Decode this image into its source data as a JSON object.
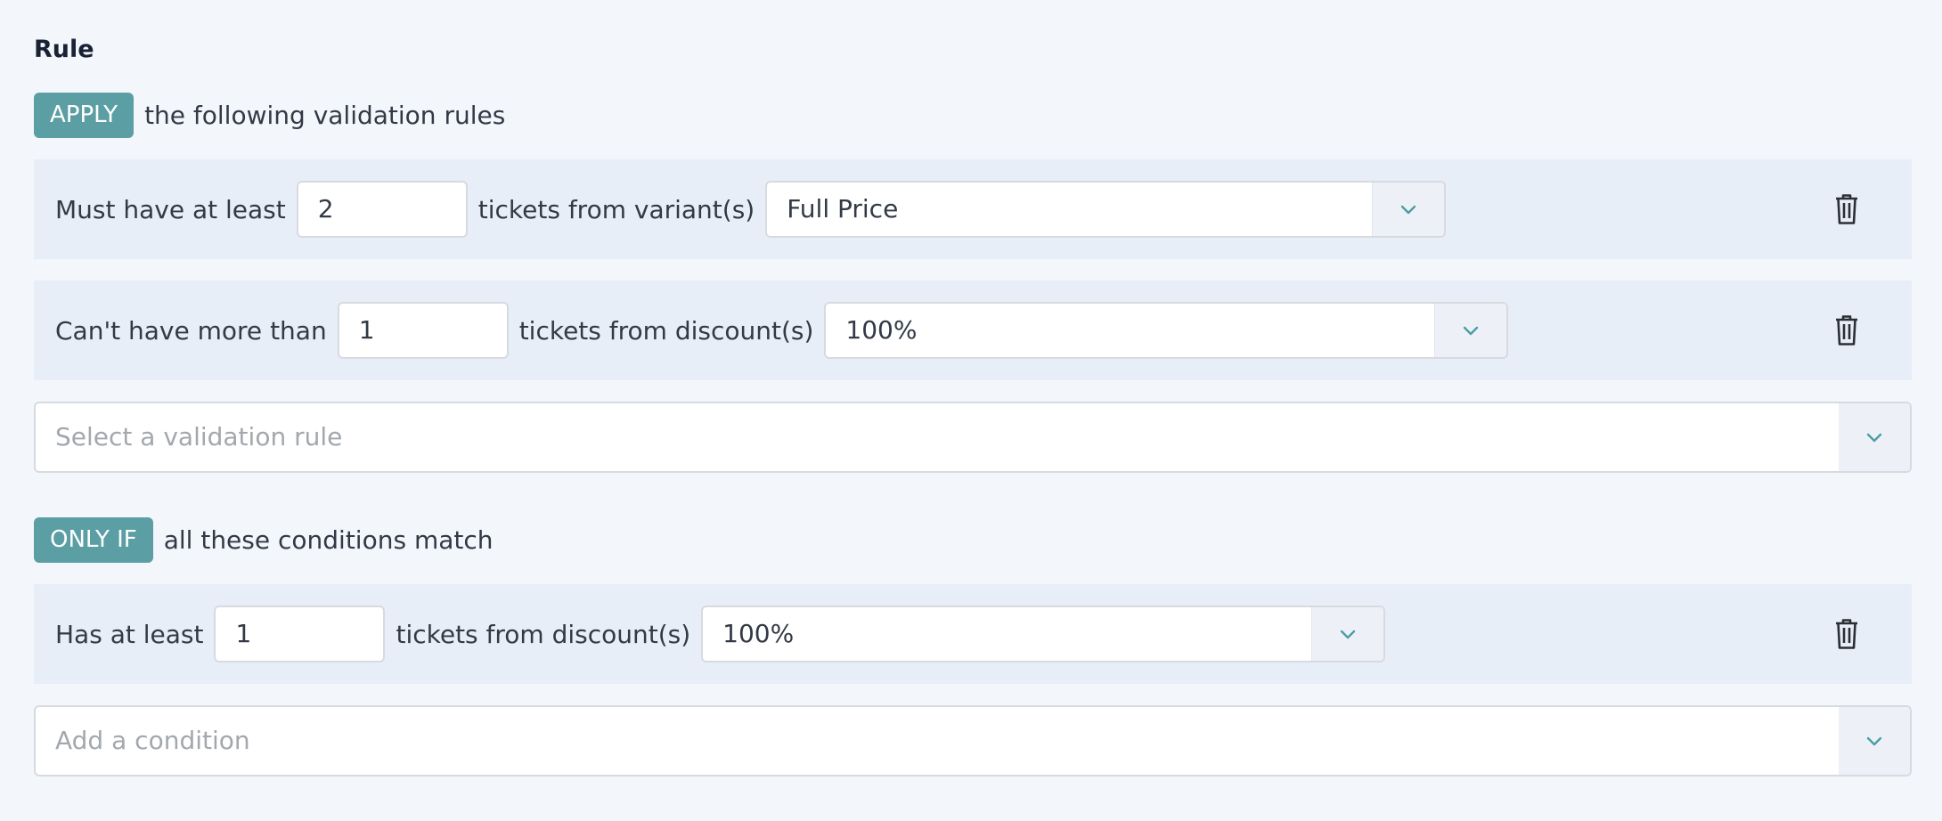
{
  "rule": {
    "title": "Rule",
    "apply": {
      "tag": "APPLY",
      "text": "the following validation rules",
      "rules": [
        {
          "prefix": "Must have at least",
          "value": "2",
          "middle": "tickets from variant(s)",
          "selected": "Full Price",
          "delete_icon": "trash-icon"
        },
        {
          "prefix": "Can't have more than",
          "value": "1",
          "middle": "tickets from discount(s)",
          "selected": "100%",
          "delete_icon": "trash-icon"
        }
      ],
      "add_placeholder": "Select a validation rule"
    },
    "only_if": {
      "tag": "ONLY IF",
      "text": "all these conditions match",
      "conditions": [
        {
          "prefix": "Has at least",
          "value": "1",
          "middle": "tickets from discount(s)",
          "selected": "100%",
          "delete_icon": "trash-icon"
        }
      ],
      "add_placeholder": "Add a condition"
    }
  },
  "colors": {
    "tag_bg": "#5b9ea3",
    "row_bg": "#e8eef7",
    "page_bg": "#f3f6fb",
    "chevron": "#4a9ea6"
  }
}
